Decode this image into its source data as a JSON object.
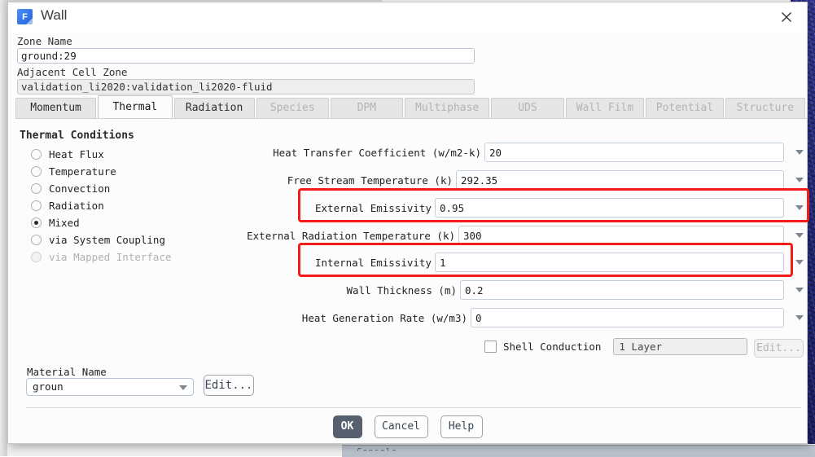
{
  "background": {
    "console_tab_label": "Console"
  },
  "dialog": {
    "title": "Wall",
    "icon": "fluent-f-icon",
    "close_icon": "close-icon",
    "zone_name_label": "Zone Name",
    "zone_name_value": "ground:29",
    "adjacent_cell_zone_label": "Adjacent Cell Zone",
    "adjacent_cell_zone_value": "validation_li2020:validation_li2020-fluid"
  },
  "tabs": [
    {
      "label": "Momentum",
      "active": false,
      "disabled": false
    },
    {
      "label": "Thermal",
      "active": true,
      "disabled": false
    },
    {
      "label": "Radiation",
      "active": false,
      "disabled": false
    },
    {
      "label": "Species",
      "active": false,
      "disabled": true
    },
    {
      "label": "DPM",
      "active": false,
      "disabled": true
    },
    {
      "label": "Multiphase",
      "active": false,
      "disabled": true
    },
    {
      "label": "UDS",
      "active": false,
      "disabled": true
    },
    {
      "label": "Wall Film",
      "active": false,
      "disabled": true
    },
    {
      "label": "Potential",
      "active": false,
      "disabled": true
    },
    {
      "label": "Structure",
      "active": false,
      "disabled": true
    }
  ],
  "thermal": {
    "section_title": "Thermal Conditions",
    "conditions": [
      {
        "label": "Heat Flux",
        "checked": false,
        "disabled": false
      },
      {
        "label": "Temperature",
        "checked": false,
        "disabled": false
      },
      {
        "label": "Convection",
        "checked": false,
        "disabled": false
      },
      {
        "label": "Radiation",
        "checked": false,
        "disabled": false
      },
      {
        "label": "Mixed",
        "checked": true,
        "disabled": false
      },
      {
        "label": "via System Coupling",
        "checked": false,
        "disabled": false
      },
      {
        "label": "via Mapped Interface",
        "checked": false,
        "disabled": true
      }
    ],
    "fields": [
      {
        "label": "Heat Transfer Coefficient (w/m2-k)",
        "value": "20",
        "highlighted": false
      },
      {
        "label": "Free Stream Temperature (k)",
        "value": "292.35",
        "highlighted": false
      },
      {
        "label": "External Emissivity",
        "value": "0.95",
        "highlighted": true
      },
      {
        "label": "External Radiation Temperature (k)",
        "value": "300",
        "highlighted": false
      },
      {
        "label": "Internal Emissivity",
        "value": "1",
        "highlighted": true
      },
      {
        "label": "Wall Thickness (m)",
        "value": "0.2",
        "highlighted": false
      },
      {
        "label": "Heat Generation Rate (w/m3)",
        "value": "0",
        "highlighted": false
      }
    ],
    "shell_conduction_label": "Shell Conduction",
    "shell_conduction_checked": false,
    "shell_layer_value": "1 Layer",
    "shell_edit_label": "Edit..."
  },
  "material": {
    "label": "Material Name",
    "value": "groun",
    "edit_label": "Edit..."
  },
  "footer": {
    "ok_label": "OK",
    "cancel_label": "Cancel",
    "help_label": "Help"
  },
  "colors": {
    "highlight": "#f41b1b",
    "ok_button": "#56606e",
    "accent_icon": "#1f62d8"
  }
}
